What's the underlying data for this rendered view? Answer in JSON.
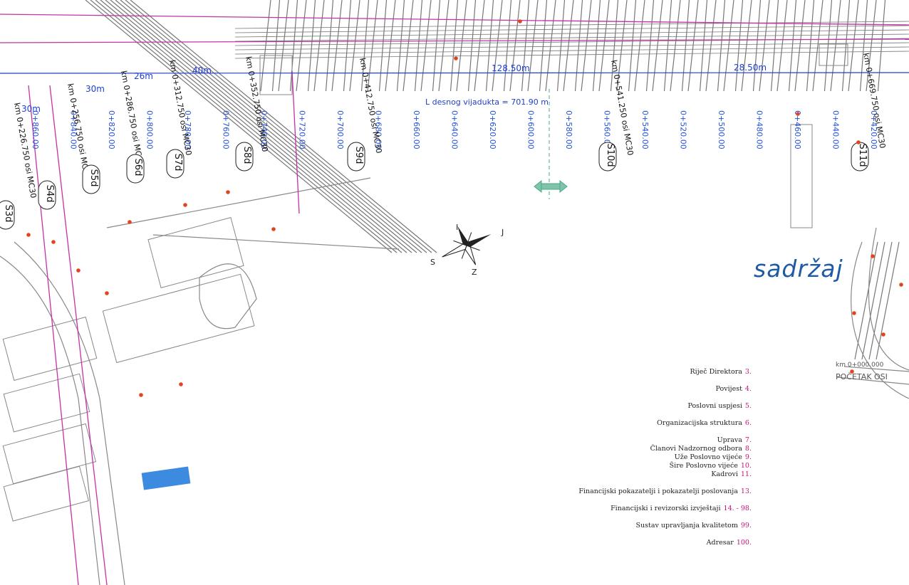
{
  "title": "sadržaj",
  "toc": [
    {
      "label": "Riječ Direktora",
      "page": "3."
    },
    {
      "label": "Povijest",
      "page": "4."
    },
    {
      "label": "Poslovni uspjesi",
      "page": "5."
    },
    {
      "label": "Organizacijska struktura",
      "page": "6."
    },
    {
      "label": "Uprava",
      "page": "7."
    },
    {
      "label": "Članovi Nadzornog odbora",
      "page": "8."
    },
    {
      "label": "Uže Poslovno vijeće",
      "page": "9."
    },
    {
      "label": "Šire Poslovno vijeće",
      "page": "10."
    },
    {
      "label": "Kadrovi",
      "page": "11."
    },
    {
      "label": "Financijski pokazatelji i pokazatelji poslovanja",
      "page": "13."
    },
    {
      "label": "Financijski i revizorski izvještaji",
      "page": "14. - 98."
    },
    {
      "label": "Sustav upravljanja kvalitetom",
      "page": "99."
    },
    {
      "label": "Adresar",
      "page": "100."
    }
  ],
  "plan": {
    "viaduct_label": "L desnog vijadukta  = 701.90 m",
    "chainage_labels": [
      "0+420.00",
      "0+440.00",
      "0+460.00",
      "0+480.00",
      "0+500.00",
      "0+520.00",
      "0+540.00",
      "0+560.00",
      "0+580.00",
      "0+600.00",
      "0+620.00",
      "0+640.00",
      "0+660.00",
      "0+680.00",
      "0+700.00",
      "0+720.00",
      "0+740.00",
      "0+760.00",
      "0+780.00",
      "0+800.00",
      "0+820.00",
      "0+840.00",
      "0+860.00"
    ],
    "span_labels": [
      "128.50m",
      "28.50m",
      "40m",
      "26m",
      "30m",
      "30m"
    ],
    "pier_labels": [
      "S4d",
      "S5d",
      "S6d",
      "S7d",
      "S8d",
      "S9d",
      "S10d",
      "S11d",
      "S3d"
    ],
    "axis_labels": [
      "km 0+226.750 osi MC30",
      "km 0+256.750 osi MC30",
      "km 0+286.750 osi MC30",
      "km 0+312.750 osi MC30",
      "km 0+352.750 osi MC30",
      "km 0+412.750 osi MC30",
      "km 0+541.250 osi MC30",
      "km 0+669.750 osi MC30"
    ],
    "compass_letters": [
      "I",
      "J",
      "Z",
      "S"
    ],
    "start_label": "POČETAK OSI",
    "start_km": "km 0+000.000"
  }
}
